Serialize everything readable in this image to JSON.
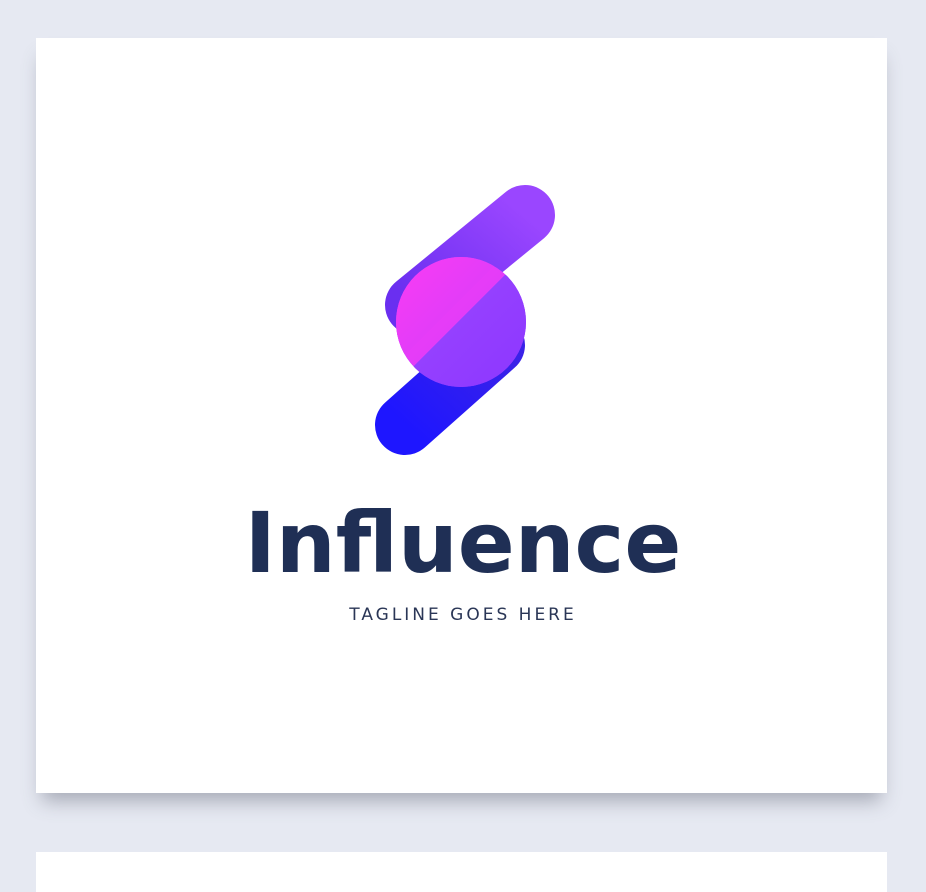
{
  "brand": {
    "name": "Influence",
    "tagline": "TAGLINE GOES HERE"
  },
  "logo": {
    "icon": "influence-logo-icon",
    "colors": {
      "top_bar": "#8a3cff",
      "bottom_bar": "#2a1dff",
      "circle_left": "#ff3af0",
      "circle_right": "#9a3cff",
      "text": "#1f2f55",
      "background": "#e6e9f2",
      "card": "#ffffff"
    }
  }
}
